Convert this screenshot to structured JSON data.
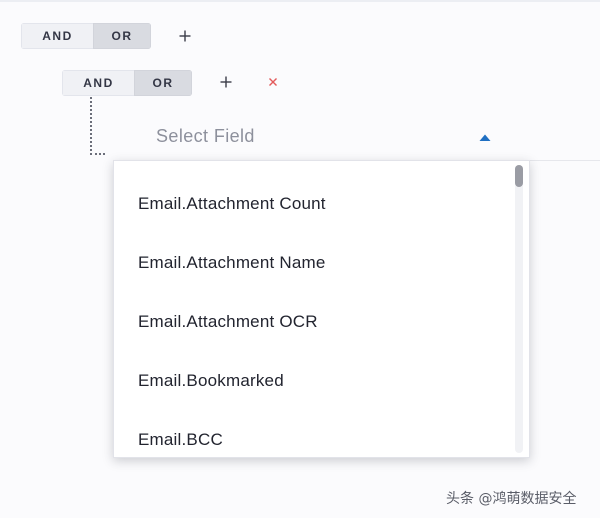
{
  "query_builder": {
    "root_group": {
      "and_label": "AND",
      "or_label": "OR",
      "selected": "OR"
    },
    "nested_group": {
      "and_label": "AND",
      "or_label": "OR",
      "selected": "OR"
    },
    "field_select": {
      "placeholder": "Select Field",
      "expanded": true,
      "options": [
        "Email.Attachment Count",
        "Email.Attachment Name",
        "Email.Attachment OCR",
        "Email.Bookmarked",
        "Email.BCC"
      ]
    }
  },
  "icons": {
    "add": "plus-icon",
    "remove": "close-icon",
    "caret": "caret-up-icon"
  },
  "colors": {
    "accent": "#1f6fc2",
    "remove": "#e35b5b",
    "selected_toggle": "#d9dbe1"
  },
  "watermark": "头条 @鸿萌数据安全"
}
